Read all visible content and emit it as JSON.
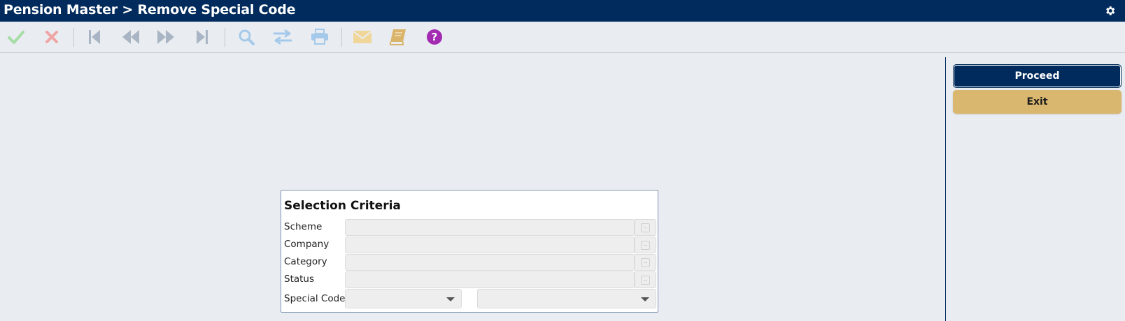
{
  "window": {
    "title": "Pension Master > Remove Special Code",
    "settings_icon": "gear-icon"
  },
  "toolbar": {
    "items": [
      {
        "name": "accept",
        "icon": "check-icon",
        "color": "#a6dca6"
      },
      {
        "name": "cancel",
        "icon": "close-icon",
        "color": "#f0a5a5"
      },
      {
        "name": "first",
        "icon": "first-record-icon",
        "color": "#a9b4c4"
      },
      {
        "name": "previous",
        "icon": "previous-record-icon",
        "color": "#a9b4c4"
      },
      {
        "name": "next",
        "icon": "next-record-icon",
        "color": "#a9b4c4"
      },
      {
        "name": "last",
        "icon": "last-record-icon",
        "color": "#a9b4c4"
      },
      {
        "name": "search",
        "icon": "search-icon",
        "color": "#a5c9ea"
      },
      {
        "name": "swap",
        "icon": "swap-icon",
        "color": "#a5c9ea"
      },
      {
        "name": "print",
        "icon": "printer-icon",
        "color": "#a5c9ea"
      },
      {
        "name": "email",
        "icon": "envelope-icon",
        "color": "#f1d69a"
      },
      {
        "name": "notes",
        "icon": "book-icon",
        "color": "#d9b46a"
      },
      {
        "name": "help",
        "icon": "help-icon",
        "color": "#a22bb2"
      }
    ]
  },
  "actions": {
    "proceed_label": "Proceed",
    "exit_label": "Exit"
  },
  "selection": {
    "title": "Selection Criteria",
    "fields": [
      {
        "label": "Scheme",
        "value": ""
      },
      {
        "label": "Company",
        "value": ""
      },
      {
        "label": "Category",
        "value": ""
      },
      {
        "label": "Status",
        "value": ""
      }
    ],
    "special_code": {
      "label": "Special Code",
      "from_value": "",
      "to_value": ""
    }
  },
  "colors": {
    "header": "#002b5c",
    "exit_button": "#d9b76f",
    "background": "#e9edf1"
  }
}
